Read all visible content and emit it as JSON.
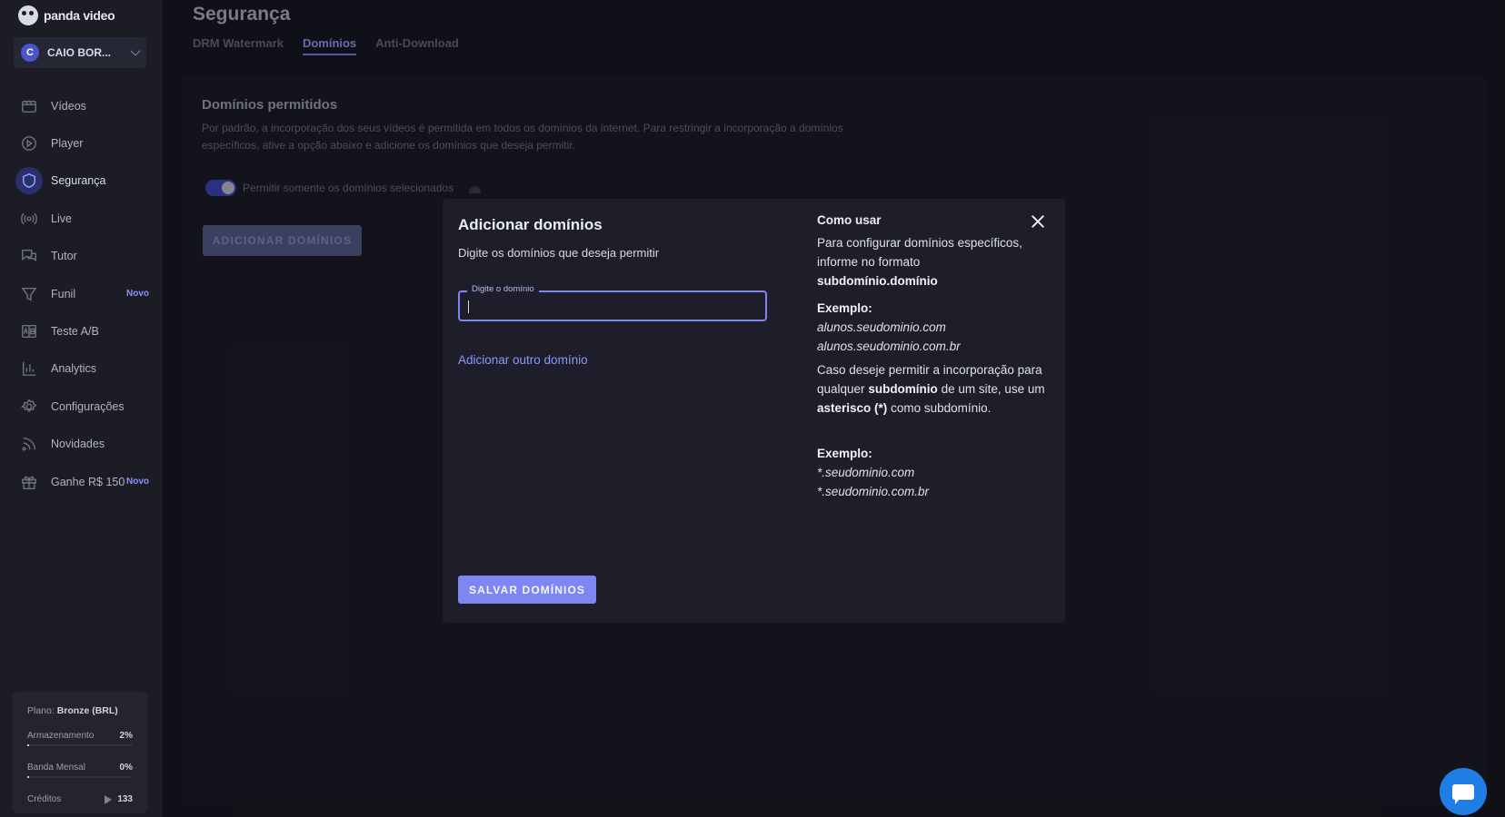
{
  "brand": {
    "name": "panda video"
  },
  "account": {
    "initial": "C",
    "name": "CAIO BOR..."
  },
  "sidebar": {
    "items": [
      {
        "label": "Vídeos",
        "icon": "video-icon"
      },
      {
        "label": "Player",
        "icon": "play-circle-icon"
      },
      {
        "label": "Segurança",
        "icon": "shield-icon",
        "active": true
      },
      {
        "label": "Live",
        "icon": "broadcast-icon"
      },
      {
        "label": "Tutor",
        "icon": "chat-icon"
      },
      {
        "label": "Funil",
        "icon": "funnel-icon",
        "badge": "Novo"
      },
      {
        "label": "Teste A/B",
        "icon": "ab-test-icon"
      },
      {
        "label": "Analytics",
        "icon": "bar-chart-icon"
      },
      {
        "label": "Configurações",
        "icon": "gear-icon"
      },
      {
        "label": "Novidades",
        "icon": "rss-icon"
      },
      {
        "label": "Ganhe R$ 150",
        "icon": "gift-icon",
        "badge": "Novo"
      }
    ]
  },
  "plan": {
    "label": "Plano:",
    "name": "Bronze (BRL)",
    "storage_label": "Armazenamento",
    "storage_pct": "2%",
    "storage_fraction": 0.02,
    "bandwidth_label": "Banda Mensal",
    "bandwidth_pct": "0%",
    "bandwidth_fraction": 0.0,
    "credits_label": "Créditos",
    "credits_value": "133"
  },
  "header": {
    "title": "Segurança",
    "tabs": [
      {
        "label": "DRM Watermark"
      },
      {
        "label": "Domínios",
        "active": true
      },
      {
        "label": "Anti-Download"
      }
    ]
  },
  "domains": {
    "title": "Domínios permitidos",
    "description": "Por padrão, a incorporação dos seus vídeos é permitida em todos os domínios da internet. Para restringir a incorporação a domínios específicos, ative a opção abaixo e adicione os domínios que deseja permitir.",
    "toggle_label": "Permitir somente os domínios selecionados",
    "toggle_on": true,
    "add_button": "ADICIONAR DOMÍNIOS"
  },
  "modal": {
    "title": "Adicionar domínios",
    "subtitle": "Digite os domínios que deseja permitir",
    "field_label": "Digite o domínio",
    "field_value": "",
    "add_other": "Adicionar outro domínio",
    "save_button": "SALVAR DOMÍNIOS",
    "help": {
      "title": "Como usar",
      "intro": "Para configurar domínios específicos, informe no formato",
      "format": "subdomínio.domínio",
      "example_label": "Exemplo:",
      "example_1": "alunos.seudominio.com",
      "example_2": "alunos.seudominio.com.br",
      "wildcard_text_1": "Caso deseje permitir a incorporação para qualquer",
      "wildcard_bold_1": "subdomínio",
      "wildcard_text_2": "de um site, use um",
      "wildcard_bold_2": "asterisco (*)",
      "wildcard_text_3": "como subdomínio.",
      "example_label_2": "Exemplo:",
      "example_3": "*.seudominio.com",
      "example_4": "*.seudominio.com.br"
    }
  },
  "colors": {
    "accent": "#7f86f2",
    "background": "#15161d",
    "sidebar": "#1b1c24",
    "modal": "#1d1e29",
    "chat": "#1f7ee6"
  }
}
